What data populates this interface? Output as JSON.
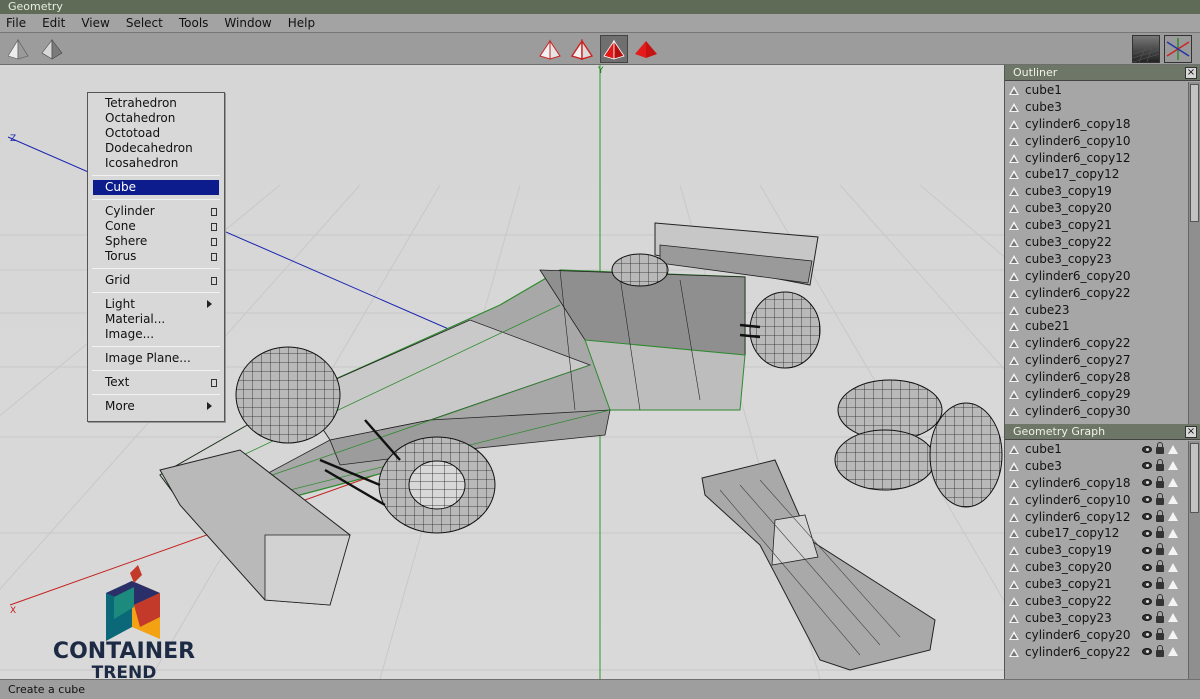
{
  "window": {
    "title": "Geometry"
  },
  "menubar": {
    "items": [
      "File",
      "Edit",
      "View",
      "Select",
      "Tools",
      "Window",
      "Help"
    ]
  },
  "toolbar": {
    "left_icons": [
      "pyramid-solid-icon",
      "pyramid-shaded-icon"
    ],
    "mode_icons": [
      "pyramid-wire-red-icon",
      "pyramid-flat-red-icon",
      "pyramid-solid-red-icon",
      "pyramid-full-red-icon"
    ],
    "right_icons": [
      "checker-render-icon",
      "axes-view-icon"
    ]
  },
  "viewport": {
    "axis_labels": {
      "x": "X",
      "y": "Y",
      "z": "Z"
    }
  },
  "context_menu": {
    "group1": [
      "Tetrahedron",
      "Octahedron",
      "Octotoad",
      "Dodecahedron",
      "Icosahedron"
    ],
    "selected": "Cube",
    "group2": [
      "Cylinder",
      "Cone",
      "Sphere",
      "Torus"
    ],
    "grid": "Grid",
    "group3": [
      "Light",
      "Material...",
      "Image..."
    ],
    "image_plane": "Image Plane...",
    "text": "Text",
    "more": "More"
  },
  "outliner": {
    "title": "Outliner",
    "items": [
      "cube1",
      "cube3",
      "cylinder6_copy18",
      "cylinder6_copy10",
      "cylinder6_copy12",
      "cube17_copy12",
      "cube3_copy19",
      "cube3_copy20",
      "cube3_copy21",
      "cube3_copy22",
      "cube3_copy23",
      "cylinder6_copy20",
      "cylinder6_copy22",
      "cube23",
      "cube21",
      "cylinder6_copy22",
      "cylinder6_copy27",
      "cylinder6_copy28",
      "cylinder6_copy29",
      "cylinder6_copy30"
    ]
  },
  "geometry_graph": {
    "title": "Geometry Graph",
    "items": [
      "cube1",
      "cube3",
      "cylinder6_copy18",
      "cylinder6_copy10",
      "cylinder6_copy12",
      "cube17_copy12",
      "cube3_copy19",
      "cube3_copy20",
      "cube3_copy21",
      "cube3_copy22",
      "cube3_copy23",
      "cylinder6_copy20",
      "cylinder6_copy22"
    ]
  },
  "status": {
    "text": "Create a cube"
  },
  "watermark": {
    "line1": "CONTAINER",
    "line2": "TREND"
  },
  "colors": {
    "selection": "#0c1c8c",
    "panel_header": "#6e7767",
    "title_bar": "#5f6b57"
  }
}
